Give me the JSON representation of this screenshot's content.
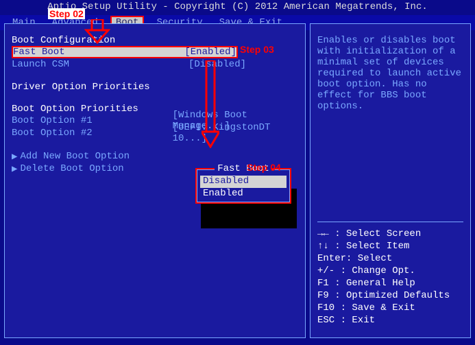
{
  "title": "Aptio Setup Utility - Copyright (C) 2012 American Megatrends, Inc.",
  "menubar": {
    "main": "Main",
    "advanced": "Advanced",
    "boot": "Boot",
    "security": "Security",
    "save_exit": "Save & Exit"
  },
  "left": {
    "section_boot_config": "Boot Configuration",
    "fast_boot": {
      "label": "Fast Boot",
      "value": "[Enabled]"
    },
    "launch_csm": {
      "label": "Launch CSM",
      "value": "[Disabled]"
    },
    "driver_priorities": "Driver Option Priorities",
    "boot_priorities": "Boot Option Priorities",
    "boot1": {
      "label": "Boot Option #1",
      "value": "[Windows Boot Manage...]"
    },
    "boot2": {
      "label": "Boot Option #2",
      "value": "[UEFI: KingstonDT 10...]"
    },
    "add_new": "Add New Boot Option",
    "delete": "Delete Boot Option"
  },
  "right": {
    "help_text": "Enables or disables boot with initialization of a minimal set of devices required to launch active boot option. Has no effect for BBS boot options.",
    "keys": {
      "k1": "→←   : Select Screen",
      "k2": "↑↓   : Select Item",
      "k3": "Enter: Select",
      "k4": "+/-  : Change Opt.",
      "k5": "F1   : General Help",
      "k6": "F9   : Optimized Defaults",
      "k7": "F10  : Save & Exit",
      "k8": "ESC  : Exit"
    }
  },
  "popup": {
    "title": "Fast Boot",
    "disabled": "Disabled",
    "enabled": "Enabled"
  },
  "annotations": {
    "step02": "Step 02",
    "step03": "Step 03",
    "step04": "Step 04"
  }
}
